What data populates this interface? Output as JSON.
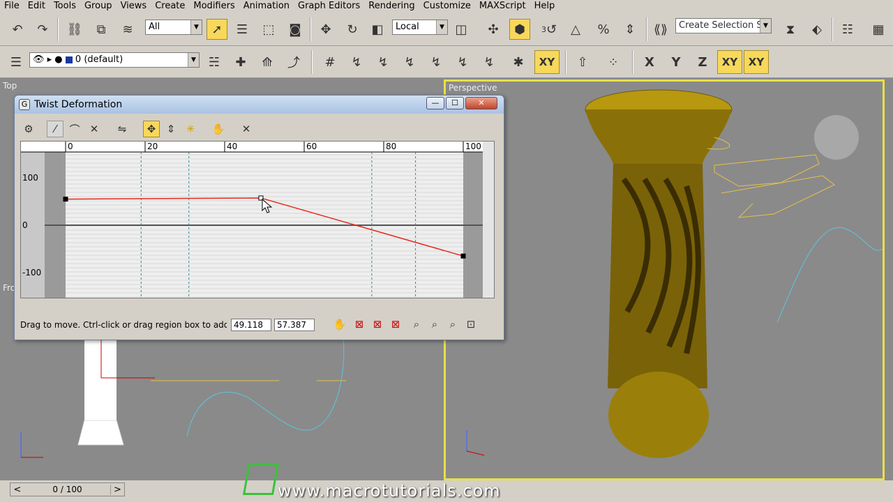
{
  "menu": [
    "File",
    "Edit",
    "Tools",
    "Group",
    "Views",
    "Create",
    "Modifiers",
    "Animation",
    "Graph Editors",
    "Rendering",
    "Customize",
    "MAXScript",
    "Help"
  ],
  "toolbar": {
    "selection_filter": "All",
    "coord_system": "Local",
    "selection_set_placeholder": "Create Selection Set",
    "layer": "0 (default)",
    "axis_x": "X",
    "axis_y": "Y",
    "axis_z": "Z",
    "axis_xy": "XY",
    "axis_xy2": "XY",
    "snap_label": "3"
  },
  "viewports": {
    "top_label": "Top",
    "front_label": "Fro",
    "persp_label": "Perspective",
    "axis_z": "z",
    "axis_x": "x"
  },
  "dialog": {
    "title": "Twist Deformation",
    "ruler_ticks": [
      "0",
      "20",
      "40",
      "60",
      "80",
      "100"
    ],
    "y_labels": [
      "100",
      "0",
      "-100"
    ],
    "status_text": "Drag to move. Ctrl-click or drag region box to add to s",
    "field_x": "49.118",
    "field_y": "57.387",
    "win_min": "—",
    "win_max": "☐",
    "win_close": "✕"
  },
  "chart_data": {
    "type": "line",
    "title": "",
    "xlabel": "",
    "ylabel": "",
    "xlim": [
      0,
      100
    ],
    "ylim": [
      -150,
      150
    ],
    "series": [
      {
        "x": [
          0,
          49.118,
          100
        ],
        "y": [
          55,
          57.387,
          -65
        ]
      }
    ],
    "dashed_x": [
      19,
      31,
      77,
      88
    ]
  },
  "statusbar": {
    "time": "0 / 100",
    "next": ">",
    "prev": "<"
  },
  "watermark": "www.macrotutorials.com",
  "colors": {
    "accent": "#f7d85b",
    "curve": "#e8291e",
    "spline": "#5bc6e0",
    "shape": "#e8c04a"
  }
}
